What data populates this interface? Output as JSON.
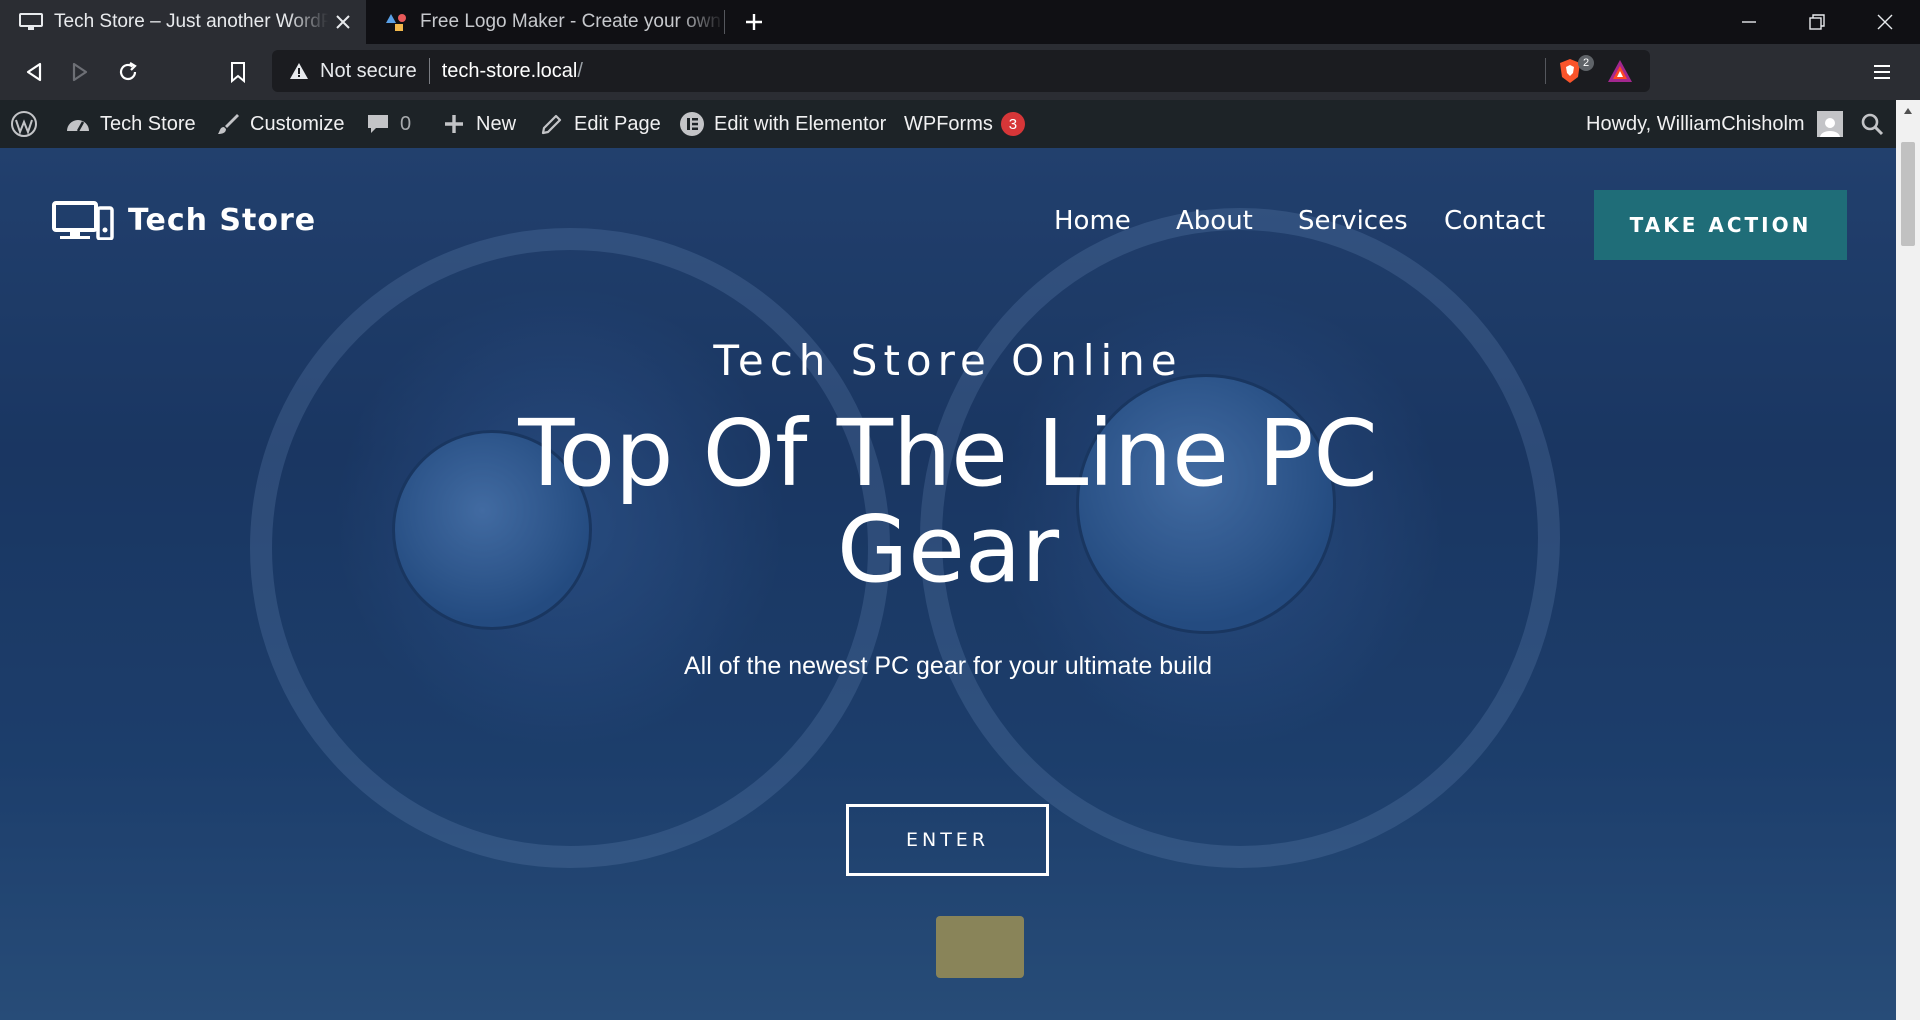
{
  "browser": {
    "tabs": [
      {
        "title": "Tech Store – Just another WordPress site",
        "icon": "monitor-icon",
        "active": true
      },
      {
        "title": "Free Logo Maker - Create your own logo",
        "icon": "shapes-icon",
        "active": false
      }
    ],
    "address": {
      "security_label": "Not secure",
      "url_host": "tech-store.local",
      "url_path": "/",
      "shield_count": "2"
    }
  },
  "adminbar": {
    "site_name": "Tech Store",
    "customize": "Customize",
    "comments_count": "0",
    "new_label": "New",
    "edit_page": "Edit Page",
    "edit_elementor": "Edit with Elementor",
    "wpforms": "WPForms",
    "wpforms_count": "3",
    "howdy": "Howdy, WilliamChisholm"
  },
  "site": {
    "logo_text": "Tech Store",
    "nav": [
      "Home",
      "About",
      "Services",
      "Contact"
    ],
    "cta_label": "TAKE ACTION"
  },
  "hero": {
    "eyebrow": "Tech Store Online",
    "headline": "Top Of The Line PC Gear",
    "subtitle": "All of the newest PC gear for your ultimate build",
    "button": "ENTER"
  },
  "colors": {
    "cta": "#1f6d78",
    "adminbar": "#1d2327",
    "badge": "#d63638"
  }
}
